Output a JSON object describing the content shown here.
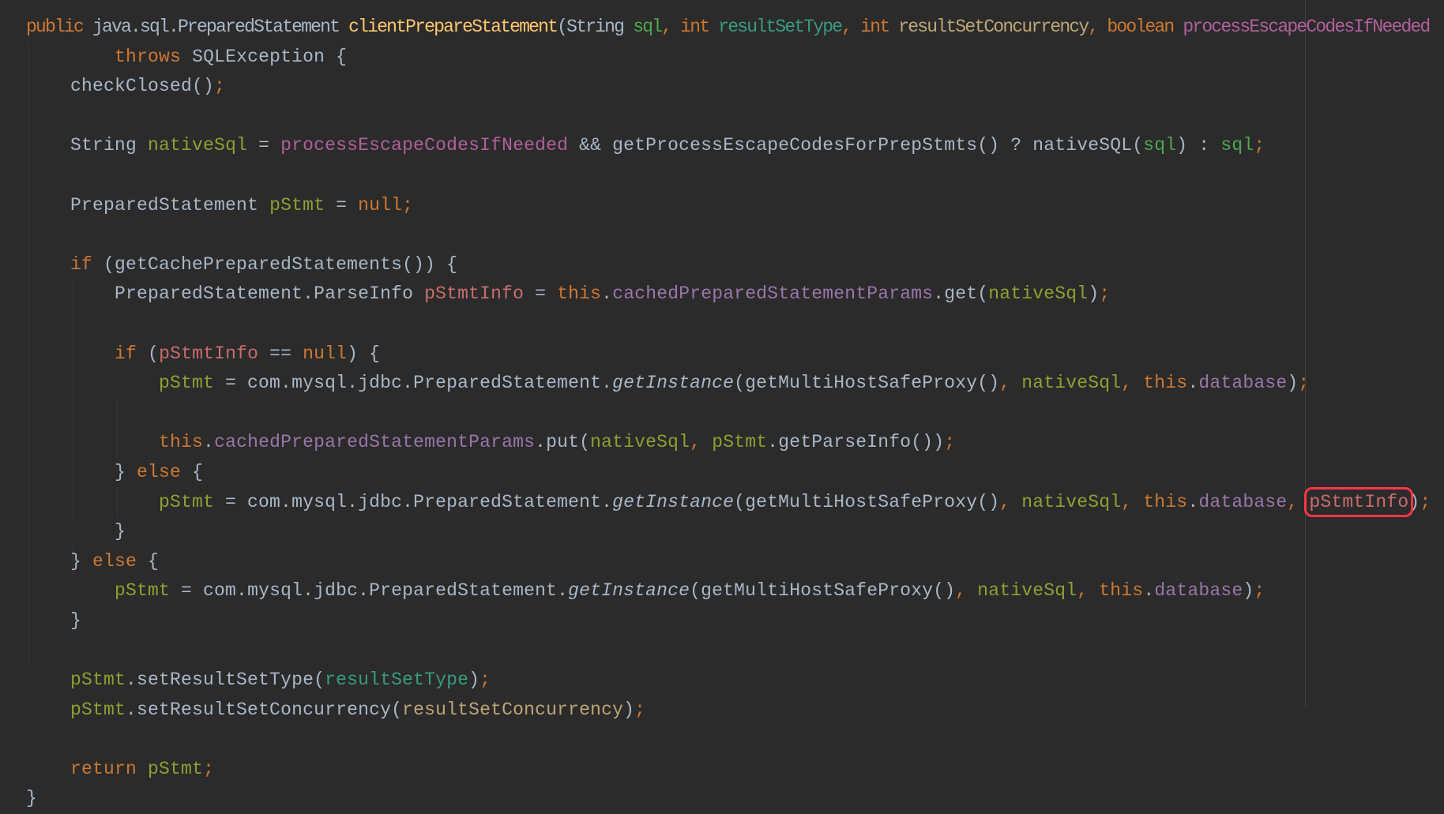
{
  "editor": {
    "colors": {
      "background": "#2b2b2b",
      "text": "#a9b7c6",
      "keyword": "#cc7832",
      "highlight_box": "#ff3547"
    },
    "lines": [
      {
        "indent": 0,
        "tokens": [
          {
            "t": "public ",
            "c": "kw"
          },
          {
            "t": "java.sql.PreparedStatement ",
            "c": "txt"
          },
          {
            "t": "clientPrepareStatement",
            "c": "decl"
          },
          {
            "t": "(String ",
            "c": "txt"
          },
          {
            "t": "sql",
            "c": "p1"
          },
          {
            "t": ", ",
            "c": "kw"
          },
          {
            "t": "int ",
            "c": "kw"
          },
          {
            "t": "resultSetType",
            "c": "p2"
          },
          {
            "t": ", ",
            "c": "kw"
          },
          {
            "t": "int ",
            "c": "kw"
          },
          {
            "t": "resultSetConcurrency",
            "c": "p3"
          },
          {
            "t": ", ",
            "c": "kw"
          },
          {
            "t": "boolean ",
            "c": "kw"
          },
          {
            "t": "processEscapeCodesIfNeeded",
            "c": "p4"
          }
        ]
      },
      {
        "indent": 8,
        "tokens": [
          {
            "t": "throws ",
            "c": "kw"
          },
          {
            "t": "SQLException {",
            "c": "txt"
          }
        ]
      },
      {
        "indent": 4,
        "tokens": [
          {
            "t": "checkClosed()",
            "c": "txt"
          },
          {
            "t": ";",
            "c": "kw"
          }
        ]
      },
      {
        "indent": 0,
        "tokens": []
      },
      {
        "indent": 4,
        "tokens": [
          {
            "t": "String ",
            "c": "txt"
          },
          {
            "t": "nativeSql",
            "c": "loc"
          },
          {
            "t": " = ",
            "c": "txt"
          },
          {
            "t": "processEscapeCodesIfNeeded",
            "c": "p4"
          },
          {
            "t": " && getProcessEscapeCodesForPrepStmts() ? nativeSQL(",
            "c": "txt"
          },
          {
            "t": "sql",
            "c": "p1"
          },
          {
            "t": ") : ",
            "c": "txt"
          },
          {
            "t": "sql",
            "c": "p1"
          },
          {
            "t": ";",
            "c": "kw"
          }
        ]
      },
      {
        "indent": 0,
        "tokens": []
      },
      {
        "indent": 4,
        "tokens": [
          {
            "t": "PreparedStatement ",
            "c": "txt"
          },
          {
            "t": "pStmt",
            "c": "loc"
          },
          {
            "t": " = ",
            "c": "txt"
          },
          {
            "t": "null",
            "c": "kw"
          },
          {
            "t": ";",
            "c": "kw"
          }
        ]
      },
      {
        "indent": 0,
        "tokens": []
      },
      {
        "indent": 4,
        "tokens": [
          {
            "t": "if ",
            "c": "kw"
          },
          {
            "t": "(getCachePreparedStatements()) {",
            "c": "txt"
          }
        ]
      },
      {
        "indent": 8,
        "tokens": [
          {
            "t": "PreparedStatement.ParseInfo ",
            "c": "txt"
          },
          {
            "t": "pStmtInfo",
            "c": "loc2"
          },
          {
            "t": " = ",
            "c": "txt"
          },
          {
            "t": "this",
            "c": "kw"
          },
          {
            "t": ".",
            "c": "txt"
          },
          {
            "t": "cachedPreparedStatementParams",
            "c": "fld"
          },
          {
            "t": ".get(",
            "c": "txt"
          },
          {
            "t": "nativeSql",
            "c": "loc"
          },
          {
            "t": ")",
            "c": "txt"
          },
          {
            "t": ";",
            "c": "kw"
          }
        ]
      },
      {
        "indent": 0,
        "tokens": []
      },
      {
        "indent": 8,
        "tokens": [
          {
            "t": "if ",
            "c": "kw"
          },
          {
            "t": "(",
            "c": "txt"
          },
          {
            "t": "pStmtInfo",
            "c": "loc2"
          },
          {
            "t": " == ",
            "c": "txt"
          },
          {
            "t": "null",
            "c": "kw"
          },
          {
            "t": ") {",
            "c": "txt"
          }
        ]
      },
      {
        "indent": 12,
        "tokens": [
          {
            "t": "pStmt",
            "c": "loc"
          },
          {
            "t": " = com.mysql.jdbc.PreparedStatement.",
            "c": "txt"
          },
          {
            "t": "getInstance",
            "c": "ital"
          },
          {
            "t": "(getMultiHostSafeProxy()",
            "c": "txt"
          },
          {
            "t": ", ",
            "c": "kw"
          },
          {
            "t": "nativeSql",
            "c": "loc"
          },
          {
            "t": ", ",
            "c": "kw"
          },
          {
            "t": "this",
            "c": "kw"
          },
          {
            "t": ".",
            "c": "txt"
          },
          {
            "t": "database",
            "c": "fld"
          },
          {
            "t": ")",
            "c": "txt"
          },
          {
            "t": ";",
            "c": "kw"
          }
        ]
      },
      {
        "indent": 0,
        "tokens": []
      },
      {
        "indent": 12,
        "tokens": [
          {
            "t": "this",
            "c": "kw"
          },
          {
            "t": ".",
            "c": "txt"
          },
          {
            "t": "cachedPreparedStatementParams",
            "c": "fld"
          },
          {
            "t": ".put(",
            "c": "txt"
          },
          {
            "t": "nativeSql",
            "c": "loc"
          },
          {
            "t": ", ",
            "c": "kw"
          },
          {
            "t": "pStmt",
            "c": "loc"
          },
          {
            "t": ".getParseInfo())",
            "c": "txt"
          },
          {
            "t": ";",
            "c": "kw"
          }
        ]
      },
      {
        "indent": 8,
        "tokens": [
          {
            "t": "} ",
            "c": "txt"
          },
          {
            "t": "else ",
            "c": "kw"
          },
          {
            "t": "{",
            "c": "txt"
          }
        ]
      },
      {
        "indent": 12,
        "tokens": [
          {
            "t": "pStmt",
            "c": "loc"
          },
          {
            "t": " = com.mysql.jdbc.PreparedStatement.",
            "c": "txt"
          },
          {
            "t": "getInstance",
            "c": "ital"
          },
          {
            "t": "(getMultiHostSafeProxy()",
            "c": "txt"
          },
          {
            "t": ", ",
            "c": "kw"
          },
          {
            "t": "nativeSql",
            "c": "loc"
          },
          {
            "t": ", ",
            "c": "kw"
          },
          {
            "t": "this",
            "c": "kw"
          },
          {
            "t": ".",
            "c": "txt"
          },
          {
            "t": "database",
            "c": "fld"
          },
          {
            "t": ", ",
            "c": "kw"
          },
          {
            "t": "pStmtInfo",
            "c": "loc2",
            "boxed": true
          },
          {
            "t": ")",
            "c": "txt"
          },
          {
            "t": ";",
            "c": "kw"
          }
        ]
      },
      {
        "indent": 8,
        "tokens": [
          {
            "t": "}",
            "c": "txt"
          }
        ]
      },
      {
        "indent": 4,
        "tokens": [
          {
            "t": "} ",
            "c": "txt"
          },
          {
            "t": "else ",
            "c": "kw"
          },
          {
            "t": "{",
            "c": "txt"
          }
        ]
      },
      {
        "indent": 8,
        "tokens": [
          {
            "t": "pStmt",
            "c": "loc"
          },
          {
            "t": " = com.mysql.jdbc.PreparedStatement.",
            "c": "txt"
          },
          {
            "t": "getInstance",
            "c": "ital"
          },
          {
            "t": "(getMultiHostSafeProxy()",
            "c": "txt"
          },
          {
            "t": ", ",
            "c": "kw"
          },
          {
            "t": "nativeSql",
            "c": "loc"
          },
          {
            "t": ", ",
            "c": "kw"
          },
          {
            "t": "this",
            "c": "kw"
          },
          {
            "t": ".",
            "c": "txt"
          },
          {
            "t": "database",
            "c": "fld"
          },
          {
            "t": ")",
            "c": "txt"
          },
          {
            "t": ";",
            "c": "kw"
          }
        ]
      },
      {
        "indent": 4,
        "tokens": [
          {
            "t": "}",
            "c": "txt"
          }
        ]
      },
      {
        "indent": 0,
        "tokens": []
      },
      {
        "indent": 4,
        "tokens": [
          {
            "t": "pStmt",
            "c": "loc"
          },
          {
            "t": ".setResultSetType(",
            "c": "txt"
          },
          {
            "t": "resultSetType",
            "c": "p2"
          },
          {
            "t": ")",
            "c": "txt"
          },
          {
            "t": ";",
            "c": "kw"
          }
        ]
      },
      {
        "indent": 4,
        "tokens": [
          {
            "t": "pStmt",
            "c": "loc"
          },
          {
            "t": ".setResultSetConcurrency(",
            "c": "txt"
          },
          {
            "t": "resultSetConcurrency",
            "c": "p3"
          },
          {
            "t": ")",
            "c": "txt"
          },
          {
            "t": ";",
            "c": "kw"
          }
        ]
      },
      {
        "indent": 0,
        "tokens": []
      },
      {
        "indent": 4,
        "tokens": [
          {
            "t": "return ",
            "c": "kw"
          },
          {
            "t": "pStmt",
            "c": "loc"
          },
          {
            "t": ";",
            "c": "kw"
          }
        ]
      },
      {
        "indent": 0,
        "tokens": [
          {
            "t": "}",
            "c": "txt"
          }
        ]
      }
    ]
  }
}
